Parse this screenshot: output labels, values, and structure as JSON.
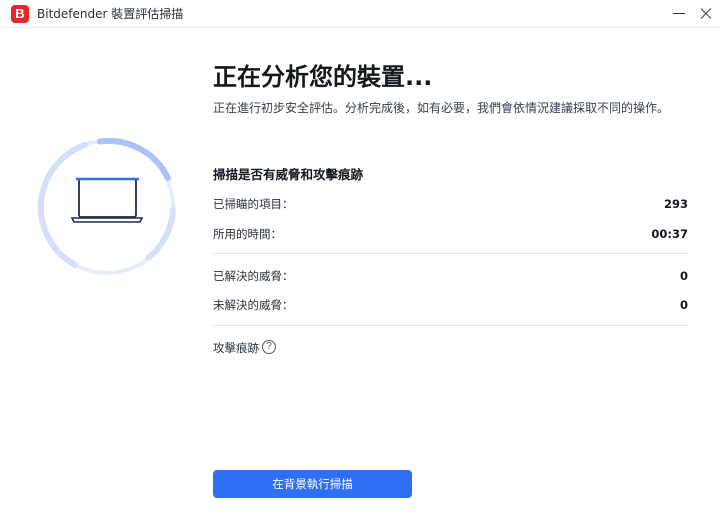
{
  "window": {
    "logo_letter": "B",
    "title": "Bitdefender 裝置評估掃描"
  },
  "scan": {
    "heading": "正在分析您的裝置...",
    "subtitle": "正在進行初步安全評估。分析完成後，如有必要，我們會依情況建議採取不同的操作。",
    "section_title": "掃描是否有威脅和攻擊痕跡",
    "stats": {
      "scanned_label": "已掃瞄的項目：",
      "scanned_value": "293",
      "time_label": "所用的時間：",
      "time_value": "00:37",
      "resolved_label": "已解決的威脅：",
      "resolved_value": "0",
      "unresolved_label": "未解決的威脅：",
      "unresolved_value": "0"
    },
    "attack_traces_label": "攻擊痕跡",
    "help_symbol": "?",
    "background_button": "在背景執行掃描"
  },
  "colors": {
    "brand_red": "#e5262a",
    "accent_blue": "#2f6ff3",
    "ring_light": "#d4e0fb",
    "ring_blue": "#a9c4f5",
    "laptop_dark": "#1e2a4a"
  },
  "icons": {
    "logo": "bitdefender-logo-icon",
    "device": "laptop-icon",
    "help": "question-circle-icon"
  }
}
